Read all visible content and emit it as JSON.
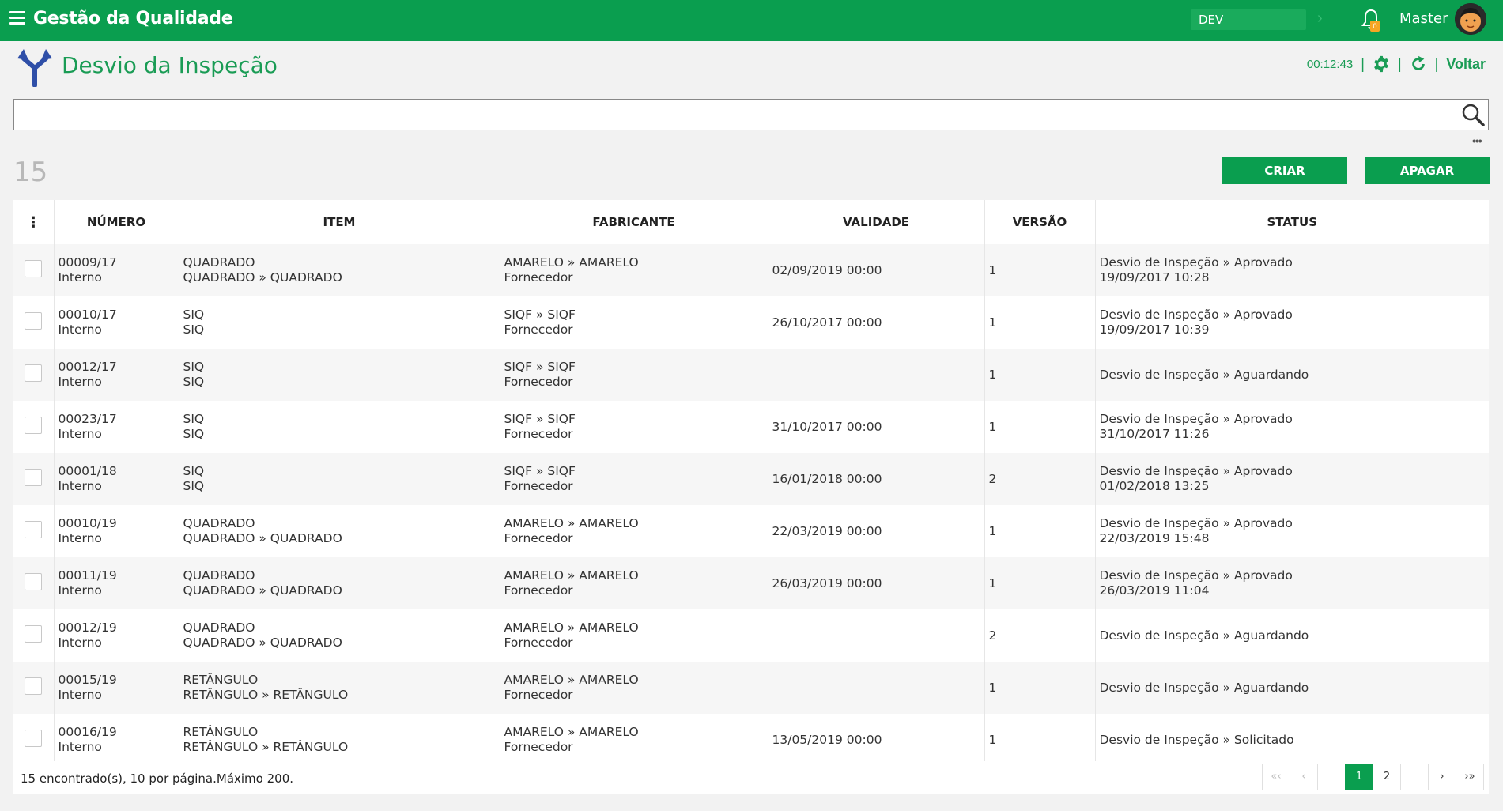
{
  "app": {
    "title": "Gestão da Qualidade",
    "environment": "DEV",
    "notifications_count": "0",
    "user_name": "Master",
    "brand_color": "#0a9e4f"
  },
  "page": {
    "title": "Desvio da Inspeção",
    "timer": "00:12:43",
    "back_label": "Voltar",
    "search_placeholder": "",
    "search_value": "",
    "count": "15",
    "create_label": "CRIAR",
    "delete_label": "APAGAR"
  },
  "table": {
    "columns": {
      "numero": "NÚMERO",
      "item": "ITEM",
      "fabricante": "FABRICANTE",
      "validade": "VALIDADE",
      "versao": "VERSÃO",
      "status": "STATUS"
    },
    "rows": [
      {
        "numero": "00009/17",
        "origem": "Interno",
        "item1": "QUADRADO",
        "item2": "QUADRADO » QUADRADO",
        "fab1": "AMARELO » AMARELO",
        "fab2": "Fornecedor",
        "validade": "02/09/2019 00:00",
        "versao": "1",
        "status1": "Desvio de Inspeção » Aprovado",
        "status2": "19/09/2017 10:28"
      },
      {
        "numero": "00010/17",
        "origem": "Interno",
        "item1": "SIQ",
        "item2": "SIQ",
        "fab1": "SIQF » SIQF",
        "fab2": "Fornecedor",
        "validade": "26/10/2017 00:00",
        "versao": "1",
        "status1": "Desvio de Inspeção » Aprovado",
        "status2": "19/09/2017 10:39"
      },
      {
        "numero": "00012/17",
        "origem": "Interno",
        "item1": "SIQ",
        "item2": "SIQ",
        "fab1": "SIQF » SIQF",
        "fab2": "Fornecedor",
        "validade": "",
        "versao": "1",
        "status1": "Desvio de Inspeção » Aguardando",
        "status2": ""
      },
      {
        "numero": "00023/17",
        "origem": "Interno",
        "item1": "SIQ",
        "item2": "SIQ",
        "fab1": "SIQF » SIQF",
        "fab2": "Fornecedor",
        "validade": "31/10/2017 00:00",
        "versao": "1",
        "status1": "Desvio de Inspeção » Aprovado",
        "status2": "31/10/2017 11:26"
      },
      {
        "numero": "00001/18",
        "origem": "Interno",
        "item1": "SIQ",
        "item2": "SIQ",
        "fab1": "SIQF » SIQF",
        "fab2": "Fornecedor",
        "validade": "16/01/2018 00:00",
        "versao": "2",
        "status1": "Desvio de Inspeção » Aprovado",
        "status2": "01/02/2018 13:25"
      },
      {
        "numero": "00010/19",
        "origem": "Interno",
        "item1": "QUADRADO",
        "item2": "QUADRADO » QUADRADO",
        "fab1": "AMARELO » AMARELO",
        "fab2": "Fornecedor",
        "validade": "22/03/2019 00:00",
        "versao": "1",
        "status1": "Desvio de Inspeção » Aprovado",
        "status2": "22/03/2019 15:48"
      },
      {
        "numero": "00011/19",
        "origem": "Interno",
        "item1": "QUADRADO",
        "item2": "QUADRADO » QUADRADO",
        "fab1": "AMARELO » AMARELO",
        "fab2": "Fornecedor",
        "validade": "26/03/2019 00:00",
        "versao": "1",
        "status1": "Desvio de Inspeção » Aprovado",
        "status2": "26/03/2019 11:04"
      },
      {
        "numero": "00012/19",
        "origem": "Interno",
        "item1": "QUADRADO",
        "item2": "QUADRADO » QUADRADO",
        "fab1": "AMARELO » AMARELO",
        "fab2": "Fornecedor",
        "validade": "",
        "versao": "2",
        "status1": "Desvio de Inspeção » Aguardando",
        "status2": ""
      },
      {
        "numero": "00015/19",
        "origem": "Interno",
        "item1": "RETÂNGULO",
        "item2": "RETÂNGULO » RETÂNGULO",
        "fab1": "AMARELO » AMARELO",
        "fab2": "Fornecedor",
        "validade": "",
        "versao": "1",
        "status1": "Desvio de Inspeção » Aguardando",
        "status2": ""
      },
      {
        "numero": "00016/19",
        "origem": "Interno",
        "item1": "RETÂNGULO",
        "item2": "RETÂNGULO » RETÂNGULO",
        "fab1": "AMARELO » AMARELO",
        "fab2": "Fornecedor",
        "validade": "13/05/2019 00:00",
        "versao": "1",
        "status1": "Desvio de Inspeção » Solicitado",
        "status2": ""
      }
    ]
  },
  "footer": {
    "found_text": "15 encontrado(s), ",
    "per_page": "10",
    "per_page_text": " por página.Máximo ",
    "max": "200",
    "max_suffix": "."
  },
  "pagination": {
    "first": "«‹",
    "prev": "‹",
    "pages": [
      "1",
      "2"
    ],
    "active": "1",
    "next": "›",
    "last": "›»"
  }
}
